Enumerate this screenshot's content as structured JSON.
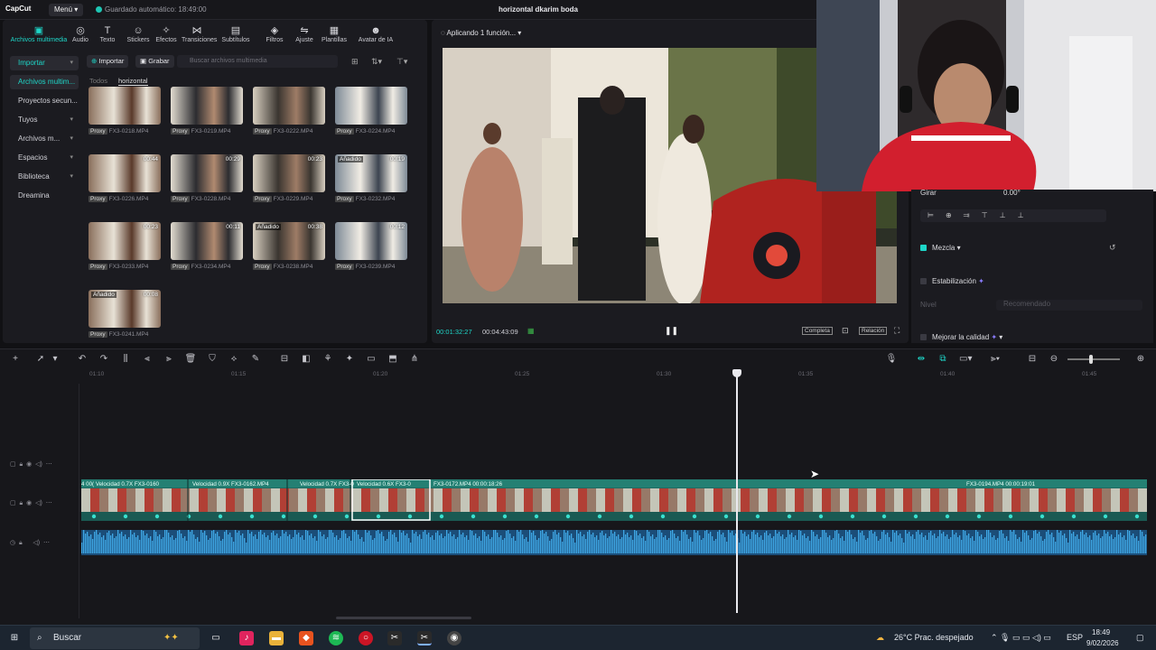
{
  "titlebar": {
    "logo": "CapCut",
    "menu": "Menú",
    "autosave": "Guardado automático: 18:49:00",
    "project_title": "horizontal dkarim boda"
  },
  "toolbar": [
    {
      "label": "Archivos multimedia",
      "icon": "media-icon"
    },
    {
      "label": "Audio",
      "icon": "audio-icon"
    },
    {
      "label": "Texto",
      "icon": "text-icon"
    },
    {
      "label": "Stickers",
      "icon": "sticker-icon"
    },
    {
      "label": "Efectos",
      "icon": "effects-icon"
    },
    {
      "label": "Transiciones",
      "icon": "transitions-icon"
    },
    {
      "label": "Subtítulos",
      "icon": "subtitles-icon"
    },
    {
      "label": "Filtros",
      "icon": "filters-icon"
    },
    {
      "label": "Ajuste",
      "icon": "adjust-icon"
    },
    {
      "label": "Plantillas",
      "icon": "templates-icon"
    },
    {
      "label": "Avatar de IA",
      "icon": "avatar-icon"
    }
  ],
  "sidebar": {
    "items": [
      {
        "label": "Importar",
        "chev": "▾"
      },
      {
        "label": "Archivos multim...",
        "chev": ""
      },
      {
        "label": "Proyectos secun...",
        "chev": ""
      },
      {
        "label": "Tuyos",
        "chev": "▾"
      },
      {
        "label": "Archivos m...",
        "chev": "▾"
      },
      {
        "label": "Espacios",
        "chev": "▾"
      },
      {
        "label": "Biblioteca",
        "chev": "▾"
      },
      {
        "label": "Dreamina",
        "chev": ""
      }
    ]
  },
  "media": {
    "import_label": "Importar",
    "record_label": "Grabar",
    "search_placeholder": "Buscar archivos multimedia",
    "tab_all": "Todos",
    "tab_folder": "horizontal",
    "proxy_label": "Proxy",
    "items": [
      {
        "name": "FX3-0218.MP4",
        "dur": "",
        "added": ""
      },
      {
        "name": "FX3-0219.MP4",
        "dur": "",
        "added": ""
      },
      {
        "name": "FX3-0222.MP4",
        "dur": "",
        "added": ""
      },
      {
        "name": "FX3-0224.MP4",
        "dur": "",
        "added": ""
      },
      {
        "name": "FX3-0226.MP4",
        "dur": "00:44",
        "added": ""
      },
      {
        "name": "FX3-0228.MP4",
        "dur": "00:29",
        "added": ""
      },
      {
        "name": "FX3-0229.MP4",
        "dur": "00:23",
        "added": ""
      },
      {
        "name": "FX3-0232.MP4",
        "dur": "00:19",
        "added": "Añadido"
      },
      {
        "name": "FX3-0233.MP4",
        "dur": "00:23",
        "added": ""
      },
      {
        "name": "FX3-0234.MP4",
        "dur": "00:11",
        "added": ""
      },
      {
        "name": "FX3-0238.MP4",
        "dur": "00:38",
        "added": "Añadido"
      },
      {
        "name": "FX3-0239.MP4",
        "dur": "00:12",
        "added": ""
      },
      {
        "name": "FX3-0241.MP4",
        "dur": "00:08",
        "added": "Añadido"
      }
    ]
  },
  "player": {
    "header": "Aplicando 1 función...",
    "current_time": "00:01:32:27",
    "total_time": "00:04:43:09",
    "btn_full": "Completa",
    "btn_ratio": "Relación"
  },
  "inspector": {
    "rotate_label": "Girar",
    "rotate_value": "0.00°",
    "blend_label": "Mezcla",
    "stabilize_label": "Estabilización",
    "level_label": "Nivel",
    "level_value": "Recomendado",
    "enhance_label": "Mejorar la calidad"
  },
  "timeline": {
    "ruler": [
      "01:10",
      "01:15",
      "01:20",
      "01:25",
      "01:30",
      "01:35",
      "01:40",
      "01:45"
    ],
    "clip_labels": [
      "4  00( Velocidad 0.7X  FX3-0160",
      "Velocidad 0.9X  FX3-0162.MP4",
      "Velocidad 0.7X  FX3-0",
      "Velocidad 0.6X  FX3-0",
      "FX3-0172.MP4  00:00:18:26",
      "FX3-0194.MP4  00:00:19:01"
    ]
  },
  "taskbar": {
    "search_label": "Buscar",
    "weather": "26°C  Prac. despejado",
    "lang": "ESP",
    "time": "18:49",
    "date": "9/02/2026"
  }
}
